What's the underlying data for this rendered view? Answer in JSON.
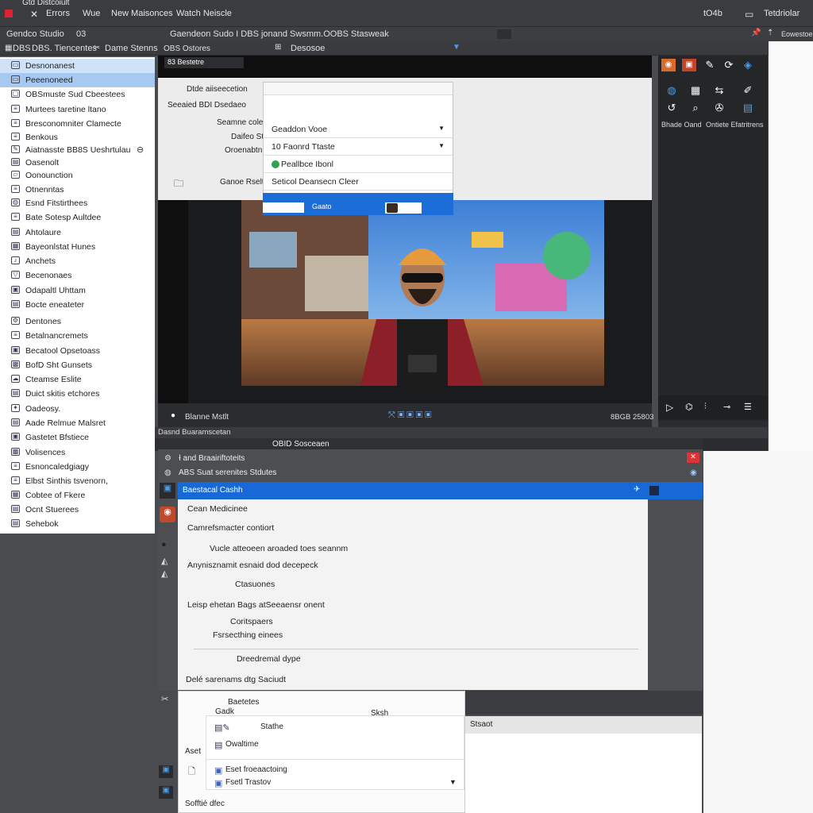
{
  "window": {
    "title": "Gtd Distcoiult",
    "menu": [
      "Errors",
      "Wue",
      "New Maisonces",
      "Watch Neiscle"
    ],
    "right_labels": [
      "tO4b",
      "Tetdriolar"
    ]
  },
  "toolbar2": {
    "app_name": "Gendco Studio",
    "item2": "03",
    "center_text": "Gaendeon Sudo  I DBS jonand Swsmm.OOBS Stasweak",
    "right_label": "Eowestoe"
  },
  "toolbar3": {
    "items": [
      "DBS",
      "DBS. Tiencentes",
      "Dame Stenns"
    ],
    "label_a": "OBS Ostores",
    "label_b": "Desosoe",
    "small_tab": "83 Bestetre"
  },
  "sidebar": {
    "items": [
      {
        "label": "Desnonanest",
        "icon": "monitor-icon"
      },
      {
        "label": "Peeenoneed",
        "icon": "monitor-icon"
      },
      {
        "label": "OBSmuste Sud Cbeestees",
        "icon": "window-icon"
      },
      {
        "label": "Murtees taretine ltano",
        "icon": "list-icon"
      },
      {
        "label": "Bresconomniter Clamecte",
        "icon": "list-icon"
      },
      {
        "label": "Benkous",
        "icon": "list-icon"
      },
      {
        "label": "Aiatnasste BB8S Ueshrtulau",
        "icon": "pen-icon"
      },
      {
        "label": "Oasenolt",
        "icon": "doc-icon"
      },
      {
        "label": "Oonounction",
        "icon": "chat-icon"
      },
      {
        "label": "Otnenntas",
        "icon": "list-icon"
      },
      {
        "label": "Esnd Fitstirthees",
        "icon": "globe-icon"
      },
      {
        "label": "Bate Sotesp Aultdee",
        "icon": "list-icon"
      },
      {
        "label": "Ahtolaure",
        "icon": "doc-icon"
      },
      {
        "label": "Bayeonlstat Hunes",
        "icon": "folder-icon"
      },
      {
        "label": "Anchets",
        "icon": "sound-icon"
      },
      {
        "label": "Becenonaes",
        "icon": "filter-icon"
      },
      {
        "label": "Odapaltl Uhttam",
        "icon": "image-icon"
      },
      {
        "label": "Bocte eneateter",
        "icon": "doc-icon"
      },
      {
        "label": "Dentones",
        "icon": "gear-icon"
      },
      {
        "label": "Betalnancremets",
        "icon": "list-icon"
      },
      {
        "label": "Becatool Opsetoass",
        "icon": "image-icon"
      },
      {
        "label": "BofD Sht Gunsets",
        "icon": "display-icon"
      },
      {
        "label": "Cteamse Eslite",
        "icon": "cloud-icon"
      },
      {
        "label": "Duict skitis etchores",
        "icon": "doc-icon"
      },
      {
        "label": "Oadeosy.",
        "icon": "settings-icon"
      },
      {
        "label": "Aade Relmue Malsret",
        "icon": "doc-icon"
      },
      {
        "label": "Gastetet Bfstiece",
        "icon": "image-icon"
      },
      {
        "label": "Volisences",
        "icon": "display-icon"
      },
      {
        "label": "Esnoncaledgiagy",
        "icon": "list-icon"
      },
      {
        "label": "Elbst Sinthis tsvenorn,",
        "icon": "list-icon"
      },
      {
        "label": "Cobtee of Fkere",
        "icon": "folder-icon"
      },
      {
        "label": "Ocnt Stuerees",
        "icon": "doc-icon"
      },
      {
        "label": "Sehebok",
        "icon": "doc-icon"
      }
    ]
  },
  "dialog": {
    "label_a": "Dtde aiiseecetion",
    "label_b": "Seeaied BDI Dsedaeo",
    "label_c": "Seamne coletid",
    "label_d": "Daifeo St",
    "label_e": "Oroenabtn",
    "label_f": "Ganoe Rselti",
    "dropdown": [
      {
        "label": "Geaddon Vooe",
        "caret": true
      },
      {
        "label": "10 Faonrd Ttaste",
        "caret": true
      },
      {
        "label": "Peallbce Ibonl",
        "caret": false
      },
      {
        "label": "Seticol Deansecn Cleer",
        "caret": false
      }
    ],
    "blue_label": "Gaato"
  },
  "preview": {
    "status_left": "Blanne Mstlt",
    "status_right": "8BGB 25803"
  },
  "right_panel": {
    "labels": [
      "Bhade Oand",
      "Ontiete Efatritrens"
    ]
  },
  "lower": {
    "strip_label": "Dasnd Buaramscetan",
    "tab_label": "OBID Sosceaen",
    "row1": "Ɨ and Braairiftoteits",
    "row2": "ABS Suat serenites Stdutes",
    "blue_header": "Baestacal Cashh",
    "popup_items": [
      "Cean Medicinee",
      "Camrefsmacter contiort",
      "Vucle atteoeen aroaded toes seannm",
      "Anynisznamit esnaid dod decepeck",
      "Ctasuones",
      "Leisp ehetan Bags atSeeaensr onent",
      "Coritspaers",
      "Fsrsecthing einees",
      "Dreedremal dype",
      "Delé sarenams dtg Saciudt"
    ],
    "lower_popup": {
      "header_a": "Baetetes",
      "header_b": "Gadk",
      "side_label": "Aset",
      "search_text": "Sksh",
      "items": [
        "Stathe",
        "Owaltime",
        "Eset froeaactoing",
        "Fsetl Trastov"
      ],
      "bottom": "Sofftié dfec",
      "right_header": "Stsaot"
    }
  },
  "colors": {
    "accent": "#1b6ed8",
    "dark_bg": "#252628",
    "panel_bg": "#4a4b4f",
    "selection": "#a7c9f1"
  }
}
